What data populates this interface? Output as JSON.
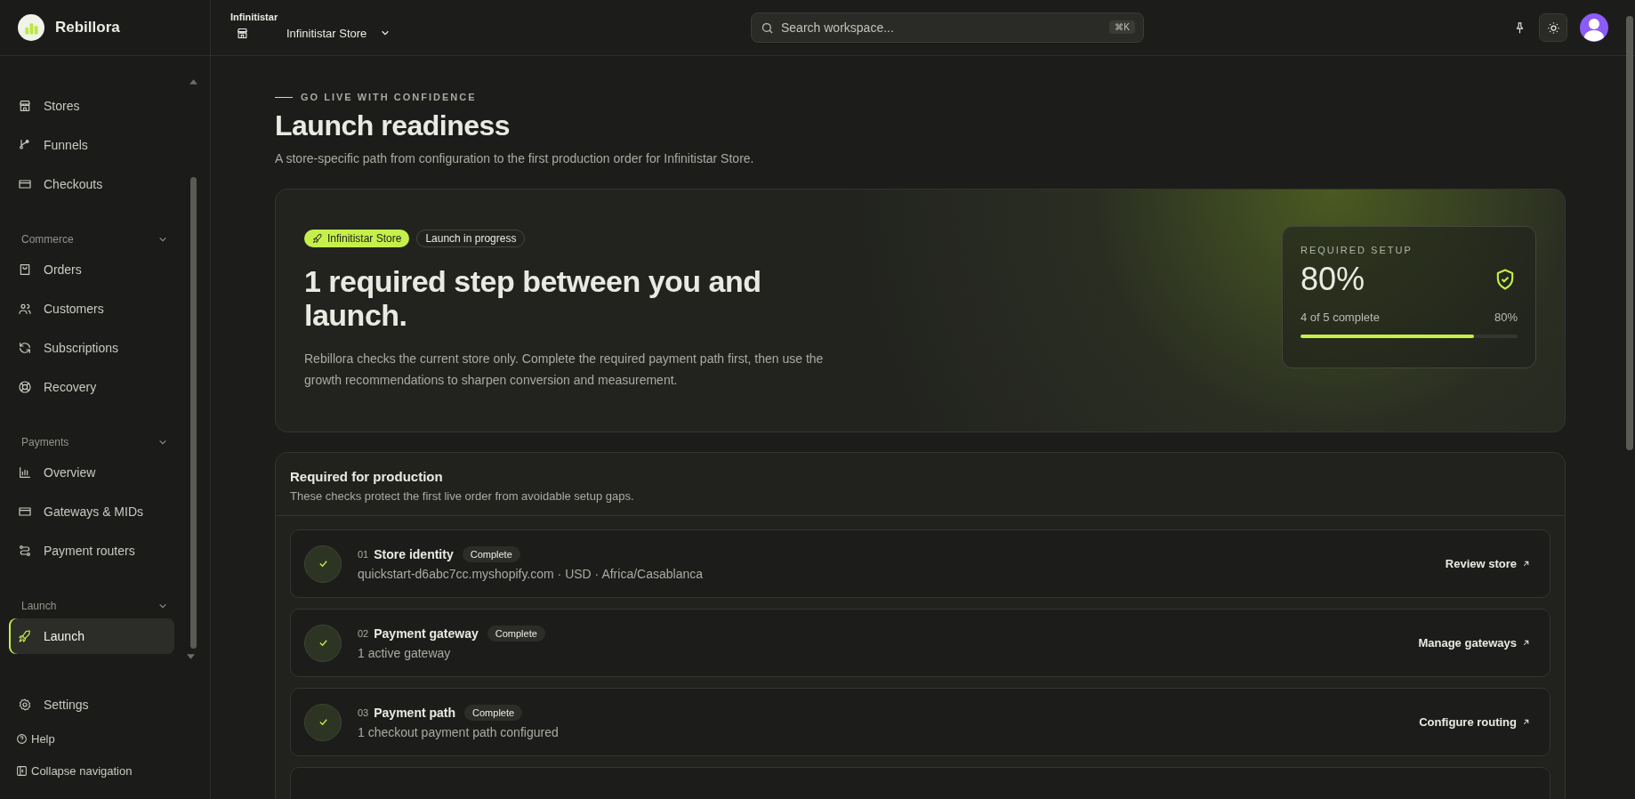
{
  "brand": {
    "name": "Rebillora"
  },
  "sidebar": {
    "top_items": [
      {
        "label": "Stores",
        "selected": false
      },
      {
        "label": "Funnels",
        "selected": false
      },
      {
        "label": "Checkouts",
        "selected": false
      }
    ],
    "sections": [
      {
        "title": "Commerce",
        "expanded": true,
        "items": [
          {
            "label": "Orders",
            "selected": false
          },
          {
            "label": "Customers",
            "selected": false
          },
          {
            "label": "Subscriptions",
            "selected": false
          },
          {
            "label": "Recovery",
            "selected": false
          }
        ]
      },
      {
        "title": "Payments",
        "expanded": true,
        "items": [
          {
            "label": "Overview",
            "selected": false
          },
          {
            "label": "Gateways & MIDs",
            "selected": false
          },
          {
            "label": "Payment routers",
            "selected": false
          }
        ]
      },
      {
        "title": "Launch",
        "expanded": true,
        "items": [
          {
            "label": "Launch",
            "selected": true
          }
        ]
      }
    ],
    "settings": "Settings",
    "help": "Help",
    "collapse": "Collapse navigation"
  },
  "topbar": {
    "workspace_label": "Infinitistar",
    "store": "Infinitistar Store",
    "search": {
      "placeholder": "Search workspace...",
      "shortcut": "⌘K"
    }
  },
  "page": {
    "eyebrow": "GO LIVE WITH CONFIDENCE",
    "title": "Launch readiness",
    "subtitle": "A store-specific path from configuration to the first production order for Infinitistar Store."
  },
  "hero": {
    "store_badge": "Infinitistar Store",
    "status_badge": "Launch in progress",
    "headline": "1 required step between you and launch.",
    "description": "Rebillora checks the current store only. Complete the required payment path first, then use the growth recommendations to sharpen conversion and measurement.",
    "setup": {
      "label": "REQUIRED SETUP",
      "percent": "80%",
      "progress_text": "4 of 5 complete",
      "progress_reading": "80%",
      "level": 0.8
    }
  },
  "required": {
    "title": "Required for production",
    "subtitle": "These checks protect the first live order from avoidable setup gaps.",
    "steps": [
      {
        "number": "01",
        "title": "Store identity",
        "status": "Complete",
        "complete": true,
        "detail": "quickstart-d6abc7cc.myshopify.com · USD · Africa/Casablanca",
        "action": "Review store"
      },
      {
        "number": "02",
        "title": "Payment gateway",
        "status": "Complete",
        "complete": true,
        "detail": "1 active gateway",
        "action": "Manage gateways"
      },
      {
        "number": "03",
        "title": "Payment path",
        "status": "Complete",
        "complete": true,
        "detail": "1 checkout payment path configured",
        "action": "Configure routing"
      }
    ]
  }
}
